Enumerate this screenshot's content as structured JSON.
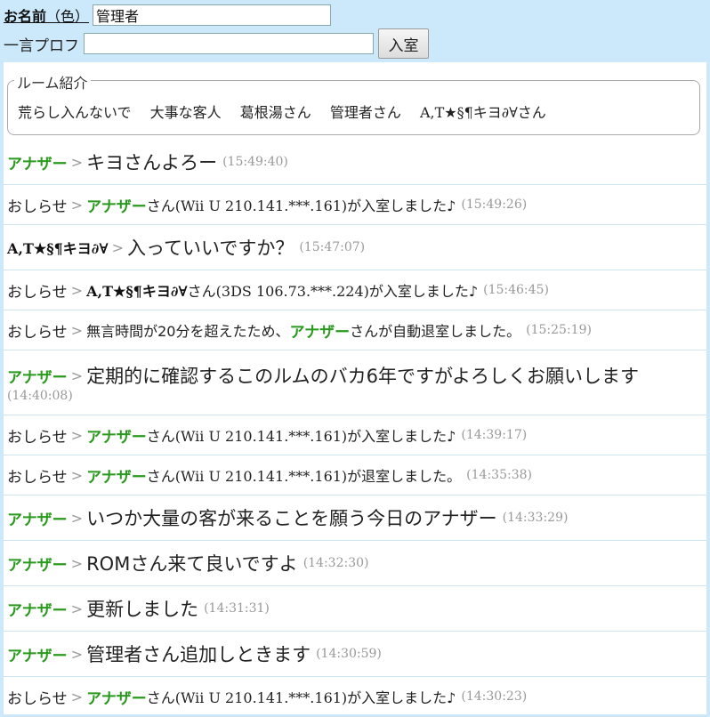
{
  "form": {
    "name_label": "お名前",
    "name_paren": "（色）",
    "name_value": "管理者",
    "prof_label": "一言プロフ",
    "prof_value": "",
    "enter_button": "入室"
  },
  "room": {
    "title": "ルーム紹介",
    "users": [
      "荒らし入んないで",
      "大事な客人",
      "葛根湯さん",
      "管理者さん",
      "A,T★§¶キヨ∂∀さん"
    ]
  },
  "messages": [
    {
      "speaker": "アナザー",
      "gt": ">",
      "text": "キヨさんよろー",
      "time": "(15:49:40)"
    },
    {
      "speaker": "おしらせ",
      "gt": ">",
      "name": "アナザー",
      "text": "さん(Wii U 210.141.***.161)が入室しました♪",
      "time": "(15:49:26)"
    },
    {
      "speaker": "A,T★§¶キヨ∂∀",
      "gt": ">",
      "text": "入っていいですか？",
      "time": "(15:47:07)"
    },
    {
      "speaker": "おしらせ",
      "gt": ">",
      "name": "A,T★§¶キヨ∂∀",
      "text": "さん(3DS 106.73.***.224)が入室しました♪",
      "time": "(15:46:45)"
    },
    {
      "speaker": "おしらせ",
      "gt": ">",
      "pre": "無言時間が20分を超えたため、",
      "name": "アナザー",
      "text": "さんが自動退室しました。",
      "time": "(15:25:19)"
    },
    {
      "speaker": "アナザー",
      "gt": ">",
      "text": "定期的に確認するこのルムのバカ6年ですがよろしくお願いします",
      "time": "(14:40:08)"
    },
    {
      "speaker": "おしらせ",
      "gt": ">",
      "name": "アナザー",
      "text": "さん(Wii U 210.141.***.161)が入室しました♪",
      "time": "(14:39:17)"
    },
    {
      "speaker": "おしらせ",
      "gt": ">",
      "name": "アナザー",
      "text": "さん(Wii U 210.141.***.161)が退室しました。",
      "time": "(14:35:38)"
    },
    {
      "speaker": "アナザー",
      "gt": ">",
      "text": "いつか大量の客が来ることを願う今日のアナザー",
      "time": "(14:33:29)"
    },
    {
      "speaker": "アナザー",
      "gt": ">",
      "text": "ROMさん来て良いですよ",
      "time": "(14:32:30)"
    },
    {
      "speaker": "アナザー",
      "gt": ">",
      "text": "更新しました",
      "time": "(14:31:31)"
    },
    {
      "speaker": "アナザー",
      "gt": ">",
      "text": "管理者さん追加しときます",
      "time": "(14:30:59)"
    },
    {
      "speaker": "おしらせ",
      "gt": ">",
      "name": "アナザー",
      "text": "さん(Wii U 210.141.***.161)が入室しました♪",
      "time": "(14:30:23)"
    }
  ],
  "colors": {
    "page_bg": "#cce9fb",
    "name_green": "#2a9a1e",
    "time_gray": "#999999"
  }
}
